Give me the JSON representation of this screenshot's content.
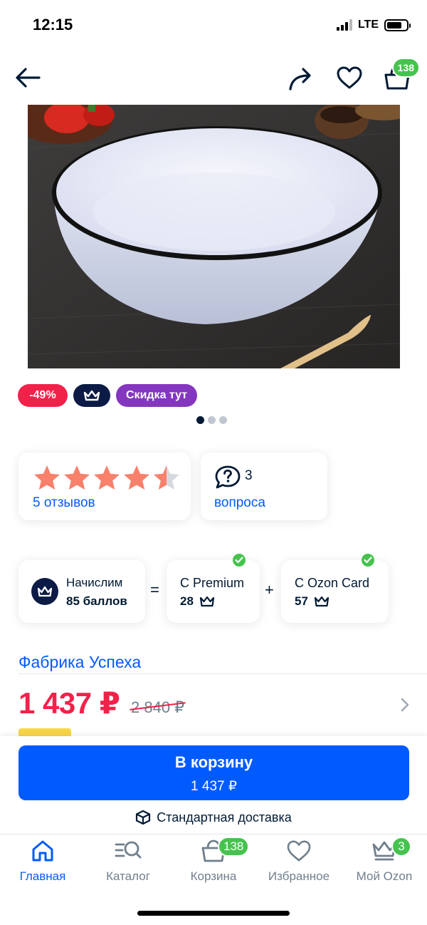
{
  "status": {
    "time": "12:15",
    "network": "LTE",
    "battery_level": 0.75
  },
  "topnav": {
    "cart_count": "138"
  },
  "badges": {
    "discount": "-49%",
    "sale": "Скидка тут"
  },
  "gallery": {
    "image_count": 3,
    "active_index": 0
  },
  "rating": {
    "stars": 4.5,
    "max_stars": 5,
    "reviews_label": "5 отзывов"
  },
  "questions": {
    "count": "3",
    "label": "вопроса"
  },
  "points": {
    "accrue_label": "Начислим",
    "accrue_value": "85 баллов",
    "equals": "=",
    "plus": "+",
    "premium_label": "С Premium",
    "premium_value": "28",
    "card_label": "С Ozon Card",
    "card_value": "57"
  },
  "seller": {
    "name": "Фабрика Успеха"
  },
  "price": {
    "current": "1 437 ₽",
    "old": "2 840 ₽"
  },
  "cart_button": {
    "label": "В корзину",
    "price": "1 437 ₽"
  },
  "delivery": {
    "label": "Стандартная доставка"
  },
  "tabbar": {
    "items": [
      {
        "label": "Главная",
        "icon": "home-icon",
        "active": true
      },
      {
        "label": "Каталог",
        "icon": "catalog-icon"
      },
      {
        "label": "Корзина",
        "icon": "cart-icon",
        "badge": "138"
      },
      {
        "label": "Избранное",
        "icon": "heart-icon"
      },
      {
        "label": "Мой Ozon",
        "icon": "crown-icon",
        "badge": "3"
      }
    ]
  },
  "colors": {
    "accent": "#005bff",
    "price": "#f1224a",
    "success": "#46c34e",
    "premium": "#0b1b45",
    "sale": "#8536bf"
  }
}
